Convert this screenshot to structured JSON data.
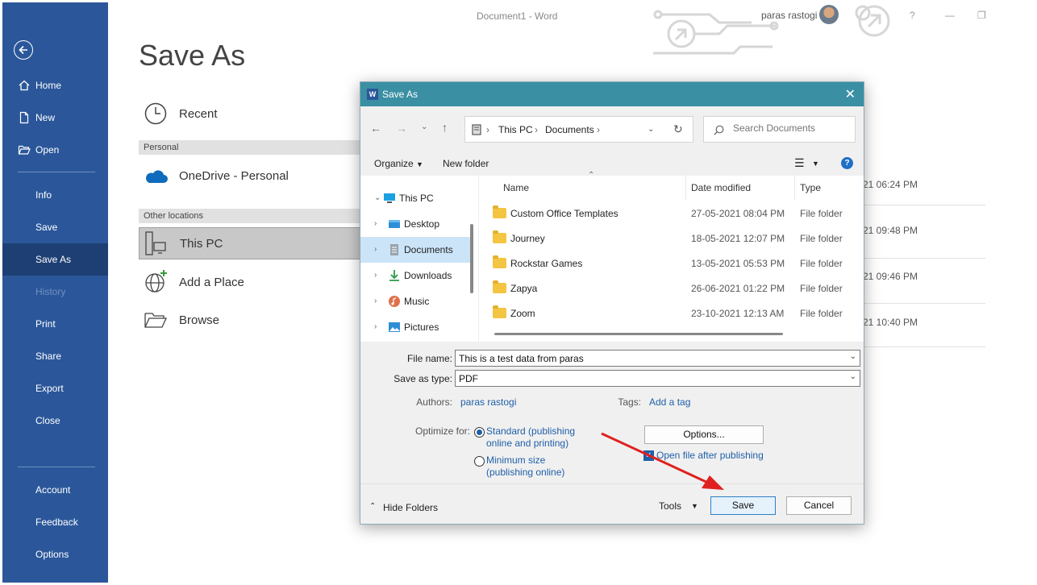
{
  "window": {
    "title": "Document1  -  Word",
    "user": "paras rastogi",
    "controls": {
      "help": "?",
      "minimize": "—",
      "restore": "❐"
    }
  },
  "backstage": {
    "heading": "Save As",
    "sidebar": {
      "items": [
        {
          "label": "Home",
          "icon": "home-icon"
        },
        {
          "label": "New",
          "icon": "new-document-icon"
        },
        {
          "label": "Open",
          "icon": "open-folder-icon"
        },
        {
          "label": "Info"
        },
        {
          "label": "Save"
        },
        {
          "label": "Save As",
          "active": true
        },
        {
          "label": "History",
          "disabled": true
        },
        {
          "label": "Print"
        },
        {
          "label": "Share"
        },
        {
          "label": "Export"
        },
        {
          "label": "Close"
        }
      ],
      "bottom_items": [
        {
          "label": "Account"
        },
        {
          "label": "Feedback"
        },
        {
          "label": "Options"
        }
      ]
    },
    "locations": {
      "recent": "Recent",
      "personal_header": "Personal",
      "onedrive": "OneDrive - Personal",
      "other_header": "Other locations",
      "this_pc": "This PC",
      "add_place": "Add a Place",
      "browse": "Browse"
    },
    "recent_times": [
      "21 06:24 PM",
      "21 09:48 PM",
      "21 09:46 PM",
      "21 10:40 PM"
    ]
  },
  "dialog": {
    "title": "Save As",
    "app_icon_letter": "W",
    "close": "✕",
    "address": {
      "root": "This PC",
      "folder": "Documents"
    },
    "search_placeholder": "Search Documents",
    "toolbar": {
      "organize": "Organize",
      "new_folder": "New folder"
    },
    "nav_pane": [
      {
        "label": "This PC",
        "expanded": true
      },
      {
        "label": "Desktop"
      },
      {
        "label": "Documents",
        "selected": true
      },
      {
        "label": "Downloads"
      },
      {
        "label": "Music"
      },
      {
        "label": "Pictures"
      }
    ],
    "columns": {
      "name": "Name",
      "date": "Date modified",
      "type": "Type"
    },
    "files": [
      {
        "name": "Custom Office Templates",
        "date": "27-05-2021 08:04 PM",
        "type": "File folder"
      },
      {
        "name": "Journey",
        "date": "18-05-2021 12:07 PM",
        "type": "File folder"
      },
      {
        "name": "Rockstar Games",
        "date": "13-05-2021 05:53 PM",
        "type": "File folder"
      },
      {
        "name": "Zapya",
        "date": "26-06-2021 01:22 PM",
        "type": "File folder"
      },
      {
        "name": "Zoom",
        "date": "23-10-2021 12:13 AM",
        "type": "File folder"
      }
    ],
    "form": {
      "file_name_label": "File name:",
      "file_name_value": "This is a test data from paras",
      "save_type_label": "Save as type:",
      "save_type_value": "PDF",
      "authors_label": "Authors:",
      "authors_value": "paras rastogi",
      "tags_label": "Tags:",
      "tags_value": "Add a tag",
      "optimize_label": "Optimize for:",
      "opt_standard_line1": "Standard (publishing",
      "opt_standard_line2": "online and printing)",
      "opt_minimum_line1": "Minimum size",
      "opt_minimum_line2": "(publishing online)",
      "options_button": "Options...",
      "open_after": "Open file after publishing",
      "open_after_checked": true
    },
    "footer": {
      "hide_folders": "Hide Folders",
      "tools": "Tools",
      "save": "Save",
      "cancel": "Cancel"
    }
  },
  "colors": {
    "sidebar": "#2b579a",
    "dialog_title": "#3a8fa3",
    "annotation_arrow": "#e02020"
  }
}
